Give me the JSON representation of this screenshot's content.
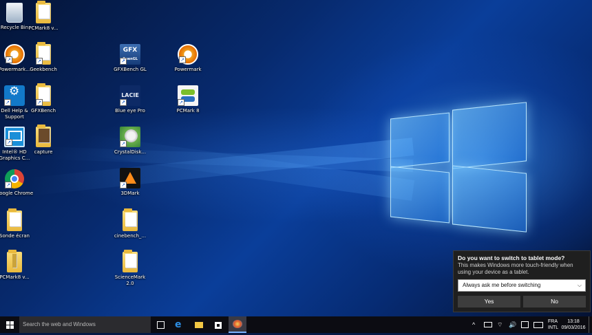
{
  "desktop": {
    "icons": [
      {
        "id": "recycle-bin",
        "label": "Recycle Bin"
      },
      {
        "id": "pcmark8-v-1",
        "label": "PCMark8 v..."
      },
      {
        "id": "powermark-1",
        "label": "Powermark..."
      },
      {
        "id": "geekbench",
        "label": "Geekbench"
      },
      {
        "id": "gfxbench-gl",
        "label": "GFXBench GL"
      },
      {
        "id": "powermark-2",
        "label": "Powermark"
      },
      {
        "id": "dell-help",
        "label": "Dell Help & Support"
      },
      {
        "id": "gfxbench",
        "label": "GFXBench"
      },
      {
        "id": "blue-eye-pro",
        "label": "Blue eye Pro"
      },
      {
        "id": "pcmark-8",
        "label": "PCMark 8"
      },
      {
        "id": "intel-hd",
        "label": "Intel® HD Graphics C..."
      },
      {
        "id": "capture",
        "label": "capture"
      },
      {
        "id": "crystaldisk",
        "label": "CrystalDisk..."
      },
      {
        "id": "google-chrome",
        "label": "Google Chrome"
      },
      {
        "id": "3dmark",
        "label": "3DMark"
      },
      {
        "id": "sonde-ecran",
        "label": "Sonde écran"
      },
      {
        "id": "cinebench",
        "label": "cinebench_..."
      },
      {
        "id": "pcmark8-v-2",
        "label": "PCMark8 v..."
      },
      {
        "id": "sciencemark",
        "label": "ScienceMark 2.0"
      }
    ],
    "glyph_text": {
      "gfx": "GFX",
      "gfx_sub": "OpenGL",
      "lace": "LACIE"
    }
  },
  "popup": {
    "title": "Do you want to switch to tablet mode?",
    "description": "This makes Windows more touch-friendly when using your device as a tablet.",
    "selected_option": "Always ask me before switching",
    "yes_label": "Yes",
    "no_label": "No"
  },
  "taskbar": {
    "search_placeholder": "Search the web and Windows",
    "language_line1": "FRA",
    "language_line2": "INTL",
    "time": "13:18",
    "date": "09/03/2016"
  },
  "colors": {
    "accent": "#0a3e9a",
    "popup_bg": "#1f1f1f",
    "taskbar_bg": "#0c0c12"
  }
}
